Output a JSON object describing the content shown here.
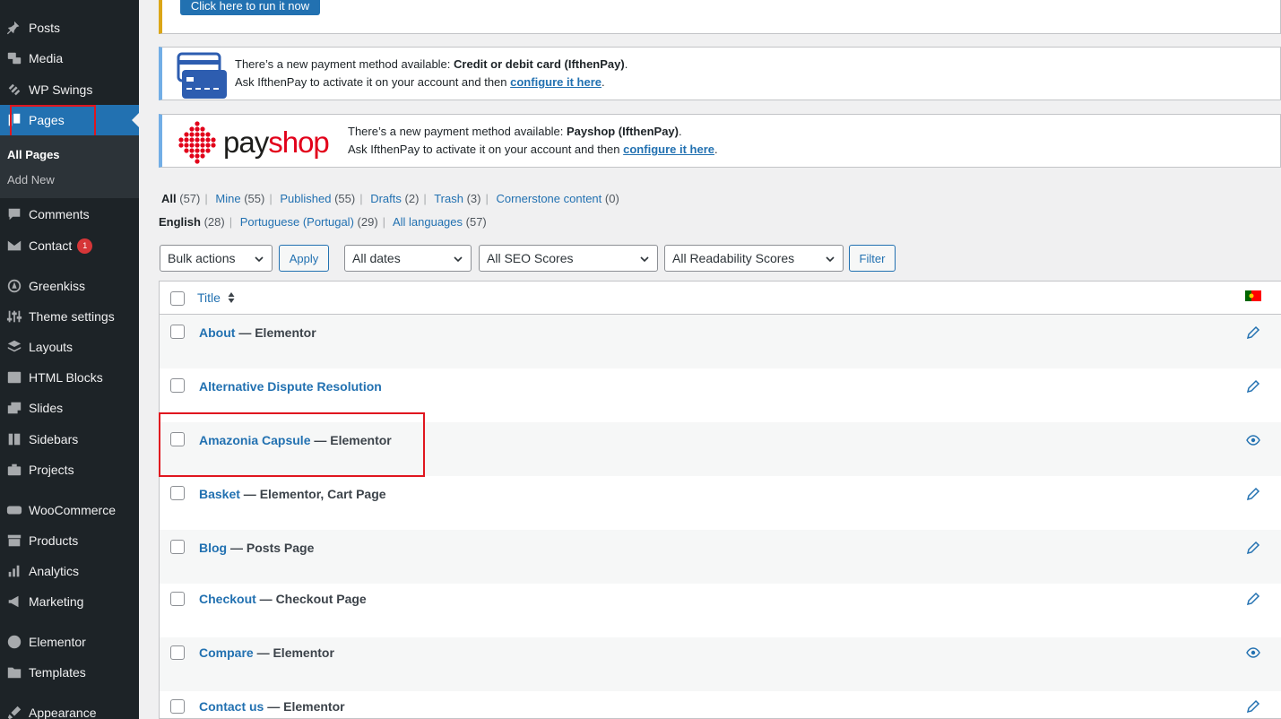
{
  "sidebar": {
    "items": [
      {
        "label": "Posts"
      },
      {
        "label": "Media"
      },
      {
        "label": "WP Swings"
      },
      {
        "label": "Pages"
      },
      {
        "label": "Comments"
      },
      {
        "label": "Contact"
      },
      {
        "label": "Greenkiss"
      },
      {
        "label": "Theme settings"
      },
      {
        "label": "Layouts"
      },
      {
        "label": "HTML Blocks"
      },
      {
        "label": "Slides"
      },
      {
        "label": "Sidebars"
      },
      {
        "label": "Projects"
      },
      {
        "label": "WooCommerce"
      },
      {
        "label": "Products"
      },
      {
        "label": "Analytics"
      },
      {
        "label": "Marketing"
      },
      {
        "label": "Elementor"
      },
      {
        "label": "Templates"
      },
      {
        "label": "Appearance"
      }
    ],
    "contact_badge": "1",
    "submenu": {
      "all_pages": "All Pages",
      "add_new": "Add New"
    }
  },
  "top_notice": {
    "button_label": "Click here to run it now"
  },
  "notice_card": {
    "line1_pre": "There’s a new payment method available: ",
    "line1_bold": "Credit or debit card (IfthenPay)",
    "line1_post": ".",
    "line2_pre": "Ask IfthenPay to activate it on your account and then ",
    "line2_link": "configure it here",
    "line2_post": "."
  },
  "notice_payshop": {
    "logo_text_1": "pay",
    "logo_text_2": "shop",
    "line1_pre": "There’s a new payment method available: ",
    "line1_bold": "Payshop (IfthenPay)",
    "line1_post": ".",
    "line2_pre": "Ask IfthenPay to activate it on your account and then ",
    "line2_link": "configure it here",
    "line2_post": "."
  },
  "views": {
    "all": "All",
    "all_count": "(57)",
    "mine": "Mine",
    "mine_count": "(55)",
    "published": "Published",
    "published_count": "(55)",
    "drafts": "Drafts",
    "drafts_count": "(2)",
    "trash": "Trash",
    "trash_count": "(3)",
    "cornerstone": "Cornerstone content",
    "cornerstone_count": "(0)",
    "sep": "|"
  },
  "languages": {
    "english": "English",
    "english_count": "(28)",
    "portuguese": "Portuguese (Portugal)",
    "portuguese_count": "(29)",
    "all": "All languages",
    "all_count": "(57)",
    "sep": "|"
  },
  "toolbar": {
    "bulk_actions": "Bulk actions",
    "apply": "Apply",
    "dates": "All dates",
    "seo": "All SEO Scores",
    "readability": "All Readability Scores",
    "filter": "Filter"
  },
  "table": {
    "title_header": "Title",
    "rows": [
      {
        "title": "About",
        "states": " — Elementor",
        "action_icon": "pencil-icon"
      },
      {
        "title": "Alternative Dispute Resolution",
        "states": "",
        "action_icon": "pencil-icon"
      },
      {
        "title": "Amazonia Capsule",
        "states": " — Elementor",
        "action_icon": "eye-icon"
      },
      {
        "title": "Basket",
        "states": " — Elementor, Cart Page",
        "action_icon": "pencil-icon"
      },
      {
        "title": "Blog",
        "states": " — Posts Page",
        "action_icon": "pencil-icon"
      },
      {
        "title": "Checkout",
        "states": " — Checkout Page",
        "action_icon": "pencil-icon"
      },
      {
        "title": "Compare",
        "states": " — Elementor",
        "action_icon": "eye-icon"
      },
      {
        "title": "Contact us",
        "states": " — Elementor",
        "action_icon": "pencil-icon"
      }
    ]
  },
  "colors": {
    "accent": "#2271b1",
    "sidebar_bg": "#1d2327",
    "highlight_box": "#e0161f",
    "payshop_red": "#e2001a"
  }
}
